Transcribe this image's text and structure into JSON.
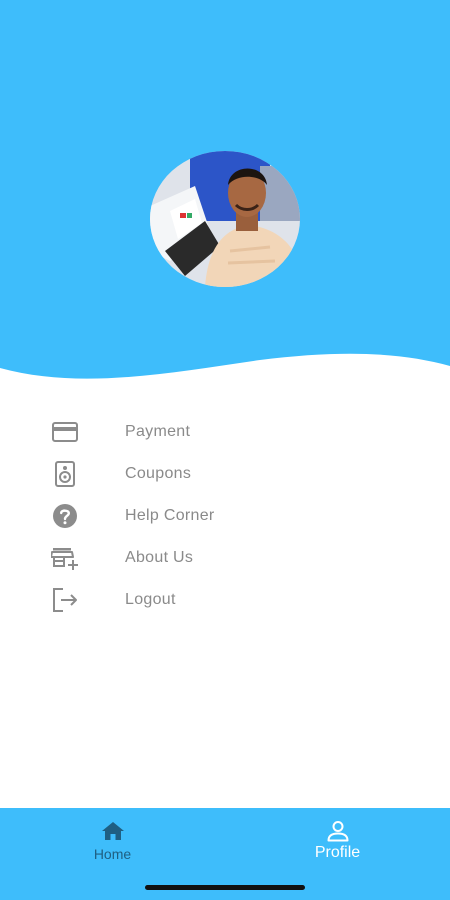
{
  "colors": {
    "primary": "#3ebdfb",
    "menu_text": "#8a8a8a",
    "menu_icon": "#8c8c8c",
    "nav_inactive": "#1f5f82",
    "nav_active": "#ffffff"
  },
  "profile": {
    "avatar_icon": "user-photo"
  },
  "menu": {
    "items": [
      {
        "label": "Payment",
        "icon": "credit-card-icon"
      },
      {
        "label": "Coupons",
        "icon": "speaker-icon"
      },
      {
        "label": "Help Corner",
        "icon": "help-circle-icon"
      },
      {
        "label": "About Us",
        "icon": "store-add-icon"
      },
      {
        "label": "Logout",
        "icon": "logout-icon"
      }
    ]
  },
  "bottom_nav": {
    "items": [
      {
        "label": "Home",
        "icon": "home-icon",
        "active": false
      },
      {
        "label": "Profile",
        "icon": "person-icon",
        "active": true
      }
    ]
  }
}
